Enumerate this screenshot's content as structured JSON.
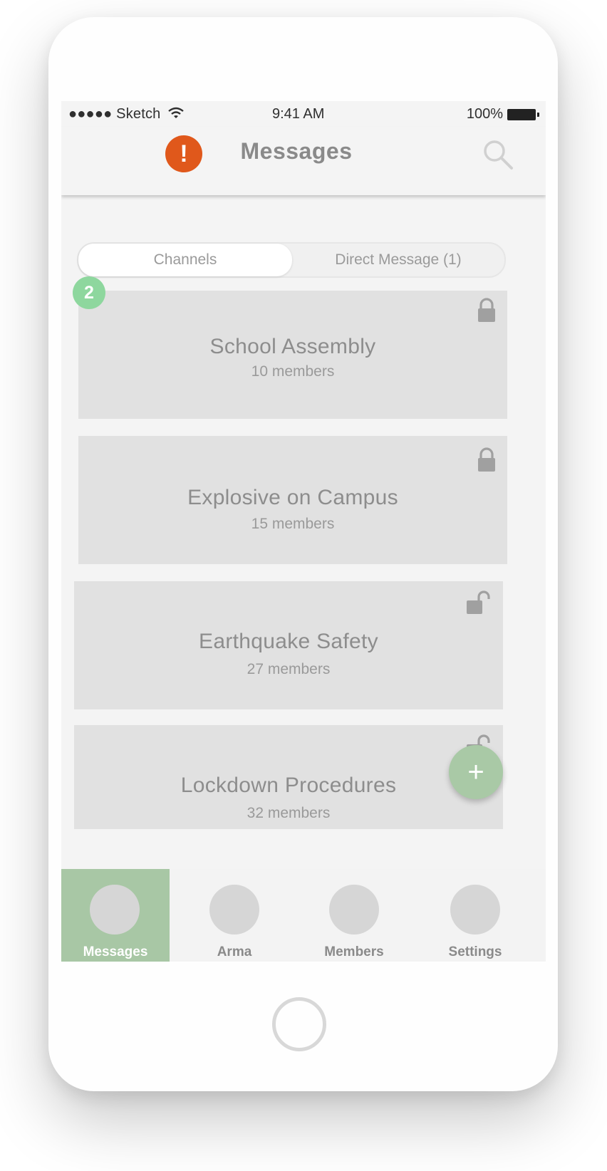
{
  "status_bar": {
    "carrier": "●●●●● Sketch",
    "time": "9:41 AM",
    "battery": "100%"
  },
  "header": {
    "title": "Messages",
    "alert_icon": "exclamation-icon",
    "alert_glyph": "!",
    "search_icon": "search-icon",
    "alert_color": "#e0581b"
  },
  "segments": [
    {
      "label": "Channels",
      "active": true
    },
    {
      "label": "Direct Message (1)",
      "active": false
    }
  ],
  "unread_badge": "2",
  "channels": [
    {
      "title": "School Assembly",
      "members": "10 members",
      "lock": "lock-closed-icon"
    },
    {
      "title": "Explosive on Campus",
      "members": "15 members",
      "lock": "lock-closed-icon"
    },
    {
      "title": "Earthquake Safety",
      "members": "27 members",
      "lock": "lock-open-icon"
    },
    {
      "title": "Lockdown Procedures",
      "members": "32 members",
      "lock": "lock-open-icon"
    }
  ],
  "fab": {
    "glyph": "+",
    "color": "#a9c9a6"
  },
  "tabbar": {
    "accent": "#a8c7a5",
    "items": [
      {
        "label": "Messages",
        "active": true
      },
      {
        "label": "Arma",
        "active": false
      },
      {
        "label": "Members",
        "active": false
      },
      {
        "label": "Settings",
        "active": false
      }
    ]
  }
}
